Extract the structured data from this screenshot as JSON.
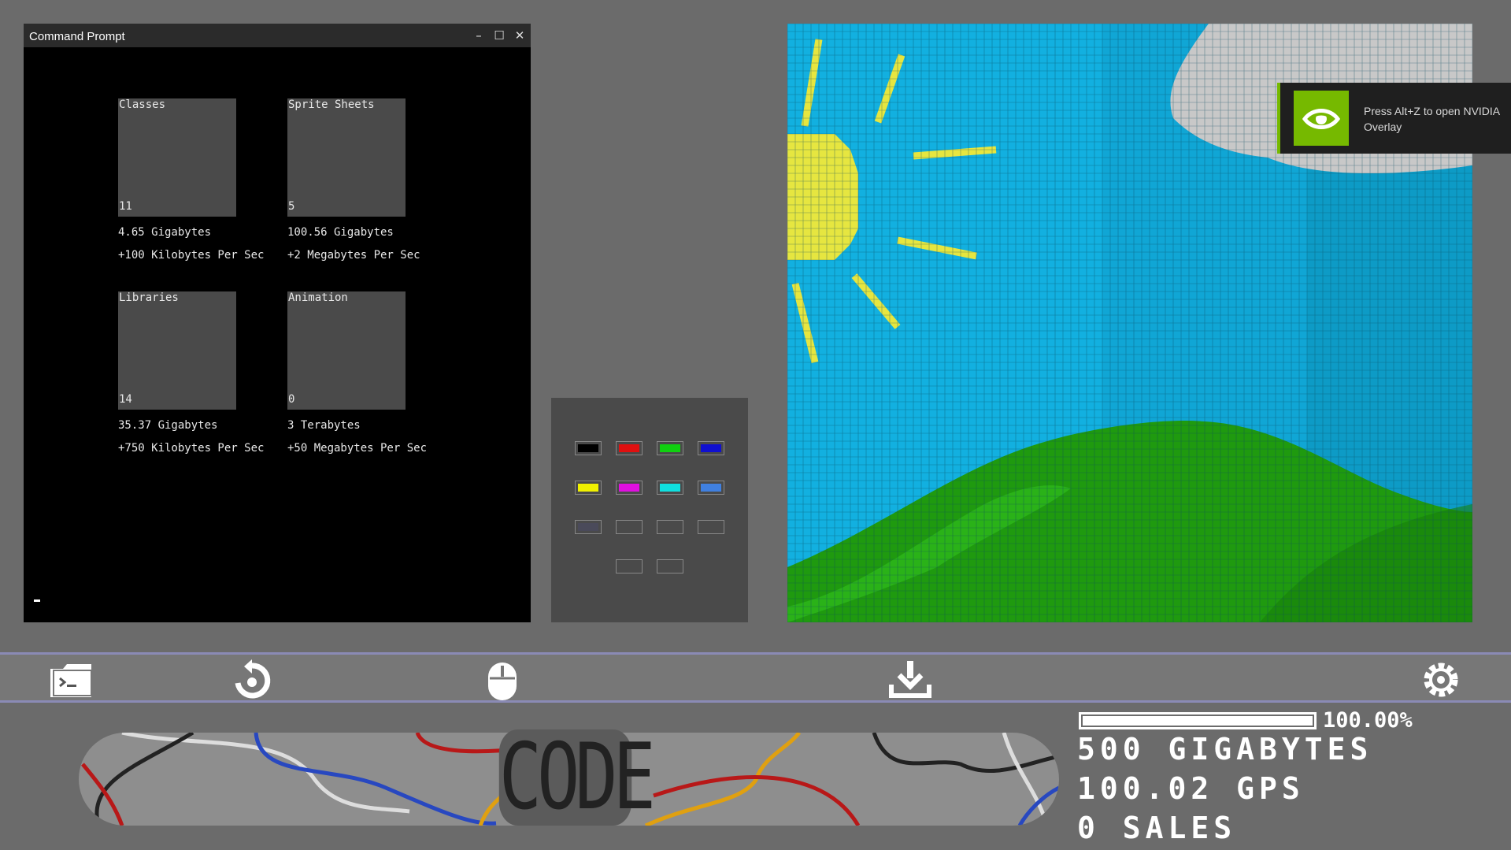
{
  "window": {
    "title": "Command Prompt",
    "controls": {
      "minimize": "–",
      "maximize": "☐",
      "close": "✕"
    }
  },
  "resources": [
    {
      "name": "Classes",
      "count": "11",
      "size": "4.65 Gigabytes",
      "rate": "+100 Kilobytes Per Sec"
    },
    {
      "name": "Sprite Sheets",
      "count": "5",
      "size": "100.56 Gigabytes",
      "rate": "+2 Megabytes Per Sec"
    },
    {
      "name": "Libraries",
      "count": "14",
      "size": "35.37 Gigabytes",
      "rate": "+750 Kilobytes Per Sec"
    },
    {
      "name": "Animation",
      "count": "0",
      "size": "3 Terabytes",
      "rate": "+50 Megabytes Per Sec"
    }
  ],
  "palette": {
    "colors": [
      "#000000",
      "#e01010",
      "#10d010",
      "#1010d0",
      "#f0f000",
      "#e010e0",
      "#10e0e0",
      "#4080e0",
      "#4a4a5a",
      "",
      "",
      "",
      "",
      ""
    ]
  },
  "canvas": {
    "colors": {
      "sky": "#12b0e0",
      "sky_dark": "#0f9cc8",
      "sun": "#e6e640",
      "cloud": "#c8c8c8",
      "grass": "#1f9a0f",
      "grass_light": "#2db81a",
      "grid": "#0a4a60"
    }
  },
  "overlay": {
    "message": "Press Alt+Z to open NVIDIA Overlay",
    "icon": "nvidia-logo-icon",
    "accent": "#76b900"
  },
  "toolbar": {
    "icons": [
      "terminal-folder-icon",
      "restart-icon",
      "mouse-icon",
      "download-icon",
      "gear-icon"
    ]
  },
  "code_button": {
    "label": "CODE"
  },
  "stats": {
    "progress_percent": "100.00%",
    "progress_fraction": 1.0,
    "storage": "500 GIGABYTES",
    "speed": "100.02 GPS",
    "sales": "0 SALES"
  }
}
